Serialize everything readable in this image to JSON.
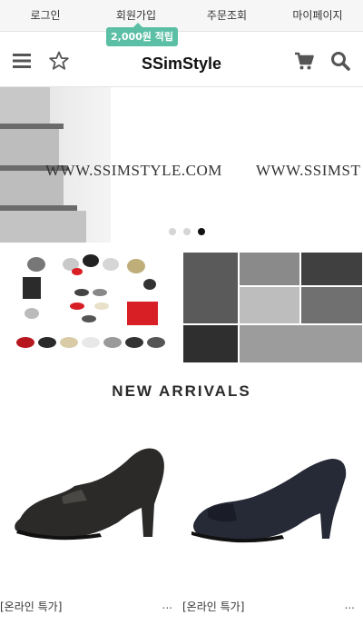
{
  "topbar": {
    "items": [
      "로그인",
      "회원가입",
      "주문조회",
      "마이페이지"
    ],
    "badge": "2,000원 적립"
  },
  "header": {
    "logo": "SSimStyle",
    "icons": [
      "menu-icon",
      "star-icon",
      "cart-icon",
      "search-icon"
    ]
  },
  "slider": {
    "text": "WWW.SSIMSTYLE.COM",
    "text_partial": "WWW.SSIMST",
    "dots": 3,
    "active_dot": 3
  },
  "section": {
    "title": "NEW ARRIVALS"
  },
  "products": [
    {
      "name": "[온라인 특가]",
      "more": "..."
    },
    {
      "name": "[온라인 특가]",
      "more": "..."
    }
  ],
  "colors": {
    "accent": "#5bbfa5",
    "icon": "#555555"
  }
}
